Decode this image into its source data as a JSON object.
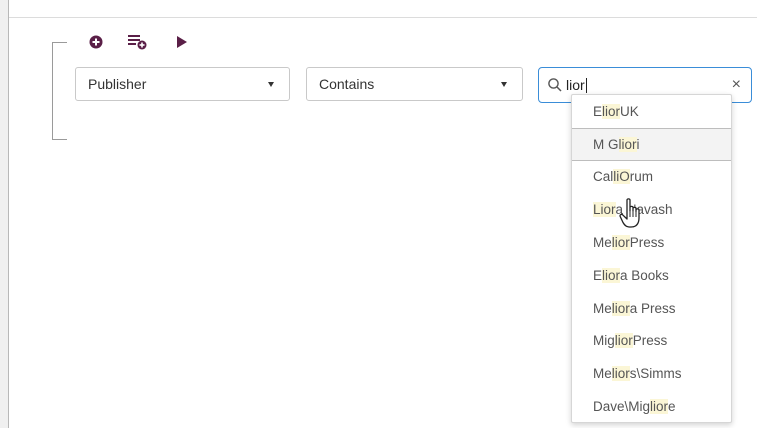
{
  "toolbar": {
    "add_icon": "plus-circle-icon",
    "add_group_icon": "playlist-add-icon",
    "run_icon": "play-icon",
    "accent_color": "#5a1f47"
  },
  "filter": {
    "field_value": "Publisher",
    "operator_value": "Contains",
    "search_value": "lior",
    "clear_symbol": "×"
  },
  "suggestions": [
    {
      "pre": "E",
      "match": "lior",
      "post": " UK"
    },
    {
      "pre": "M G",
      "match": "lior",
      "post": "i"
    },
    {
      "pre": "Cal",
      "match": "liO",
      "post": "rum"
    },
    {
      "pre": "",
      "match": "Lior",
      "post": "a Navash"
    },
    {
      "pre": "Me",
      "match": "lior",
      "post": " Press"
    },
    {
      "pre": "E",
      "match": "lior",
      "post": "a Books"
    },
    {
      "pre": "Me",
      "match": "lior",
      "post": "a Press"
    },
    {
      "pre": "Mig",
      "match": "lior",
      "post": " Press"
    },
    {
      "pre": "Me",
      "match": "lior",
      "post": "s\\Simms"
    },
    {
      "pre": "Dave\\Mig",
      "match": "lior",
      "post": "e"
    }
  ],
  "active_index": 1
}
